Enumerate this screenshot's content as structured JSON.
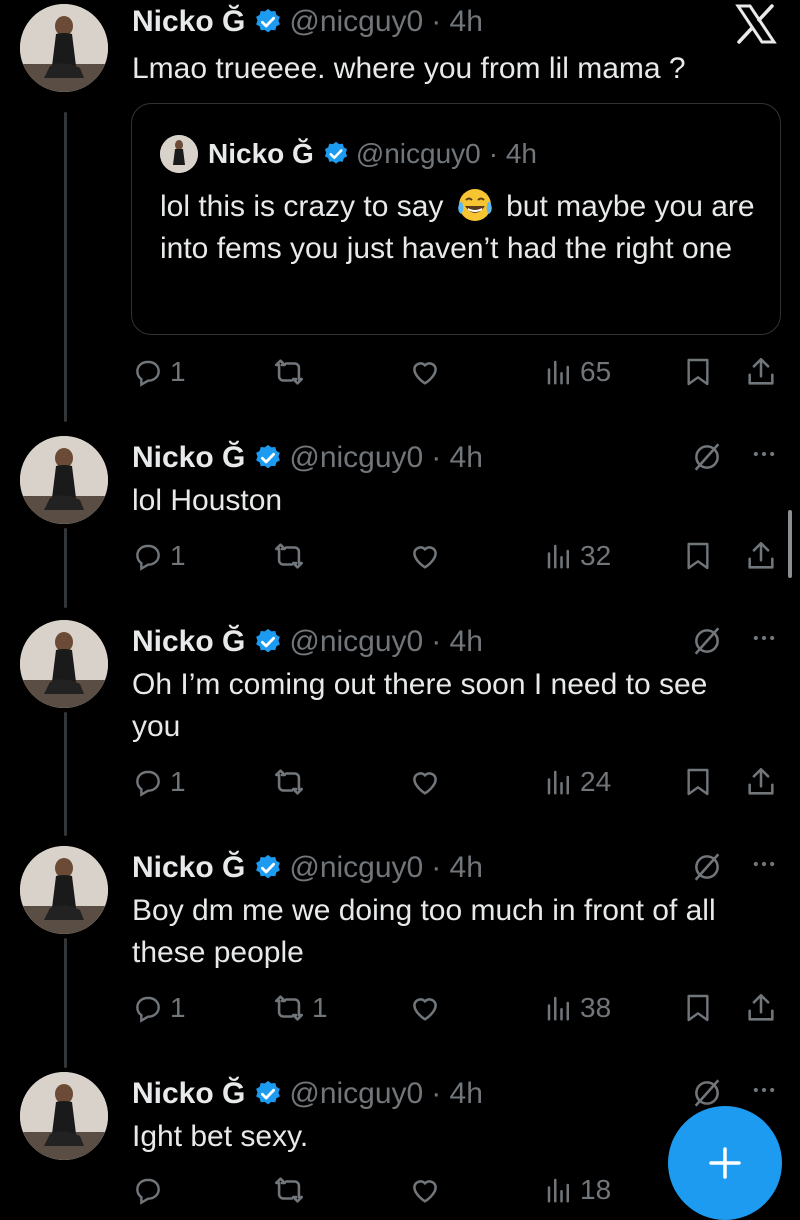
{
  "x_logo": "X",
  "colors": {
    "accent": "#1d9bf0",
    "muted": "#71767b",
    "background": "#000000"
  },
  "quote": {
    "name": "Nicko Ğ",
    "handle": "@nicguy0",
    "time": "· 4h",
    "text_before_emoji": "lol this is crazy to say",
    "emoji": "face-with-tears-of-joy",
    "text_after_emoji": "but maybe you are into fems you just haven’t had the right one"
  },
  "tweets": [
    {
      "name": "Nicko Ğ",
      "handle": "@nicguy0",
      "time": "· 4h",
      "text": "Lmao trueeee. where you from lil mama ?",
      "replies": "1",
      "reposts": "",
      "views": "65"
    },
    {
      "name": "Nicko Ğ",
      "handle": "@nicguy0",
      "time": "· 4h",
      "text": "lol Houston",
      "replies": "1",
      "reposts": "",
      "views": "32"
    },
    {
      "name": "Nicko Ğ",
      "handle": "@nicguy0",
      "time": "· 4h",
      "text": "Oh I’m coming out there soon I need to see you",
      "replies": "1",
      "reposts": "",
      "views": "24"
    },
    {
      "name": "Nicko Ğ",
      "handle": "@nicguy0",
      "time": "· 4h",
      "text": "Boy dm me we doing too much in front of all these people",
      "replies": "1",
      "reposts": "1",
      "views": "38"
    },
    {
      "name": "Nicko Ğ",
      "handle": "@nicguy0",
      "time": "· 4h",
      "text": "Ight bet sexy.",
      "replies": "",
      "reposts": "",
      "views": "18"
    }
  ],
  "fab": {
    "icon": "plus-icon"
  }
}
